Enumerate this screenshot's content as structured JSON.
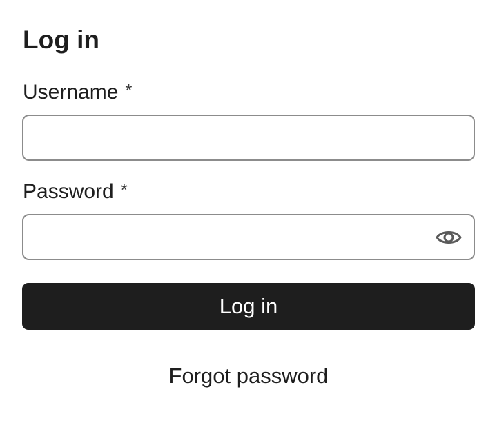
{
  "form": {
    "title": "Log in",
    "username": {
      "label": "Username",
      "required_marker": "*",
      "value": "",
      "placeholder": ""
    },
    "password": {
      "label": "Password",
      "required_marker": "*",
      "value": "",
      "placeholder": "",
      "toggle_icon": "eye-icon"
    },
    "submit_label": "Log in",
    "forgot_password_label": "Forgot password"
  },
  "colors": {
    "text": "#1e1e1e",
    "button_background": "#1e1e1e",
    "button_text": "#ffffff",
    "input_border": "#8c8c8c",
    "background": "#ffffff"
  }
}
